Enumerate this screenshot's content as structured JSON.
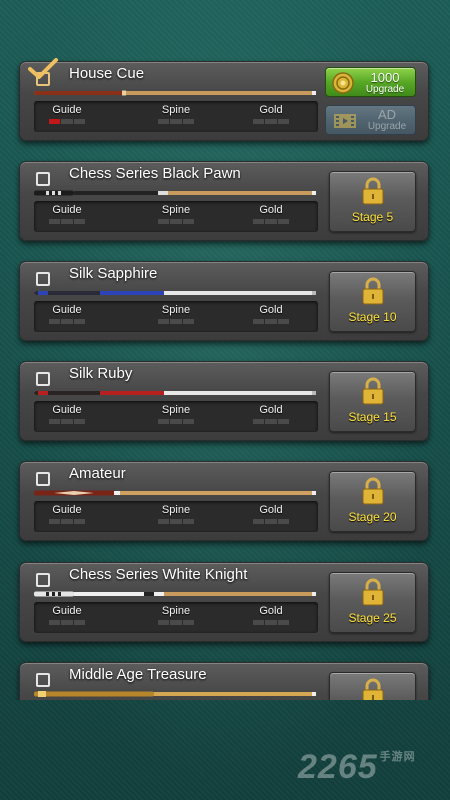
{
  "stat_labels": [
    "Guide",
    "Spine",
    "Gold"
  ],
  "colors": {
    "locked_stage_text": "#ffe23a",
    "upgrade_green": "#58a826",
    "stat_active": "#c01818",
    "background": "#1d5e58"
  },
  "cues": [
    {
      "name": "House Cue",
      "selected": true,
      "stats": [
        1,
        0,
        0
      ],
      "stat_max": 3,
      "action": {
        "type": "upgrade",
        "amount": "1000",
        "label": "Upgrade",
        "ad_label": "AD",
        "ad_sub": "Upgrade",
        "coin_icon": "coin-icon",
        "ad_icon": "film-icon"
      }
    },
    {
      "name": "Chess Series Black Pawn",
      "selected": false,
      "stats": [
        0,
        0,
        0
      ],
      "stat_max": 3,
      "action": {
        "type": "locked",
        "label": "Stage 5",
        "icon": "lock-icon"
      }
    },
    {
      "name": "Silk Sapphire",
      "selected": false,
      "stats": [
        0,
        0,
        0
      ],
      "stat_max": 3,
      "action": {
        "type": "locked",
        "label": "Stage 10",
        "icon": "lock-icon"
      }
    },
    {
      "name": "Silk Ruby",
      "selected": false,
      "stats": [
        0,
        0,
        0
      ],
      "stat_max": 3,
      "action": {
        "type": "locked",
        "label": "Stage 15",
        "icon": "lock-icon"
      }
    },
    {
      "name": "Amateur",
      "selected": false,
      "stats": [
        0,
        0,
        0
      ],
      "stat_max": 3,
      "action": {
        "type": "locked",
        "label": "Stage 20",
        "icon": "lock-icon"
      }
    },
    {
      "name": "Chess Series White Knight",
      "selected": false,
      "stats": [
        0,
        0,
        0
      ],
      "stat_max": 3,
      "action": {
        "type": "locked",
        "label": "Stage 25",
        "icon": "lock-icon"
      }
    },
    {
      "name": "Middle Age Treasure",
      "selected": false,
      "stats": [
        0,
        0,
        0
      ],
      "stat_max": 3,
      "action": {
        "type": "locked",
        "label": "",
        "icon": "lock-icon"
      }
    }
  ],
  "watermark": {
    "text": "2265",
    "suffix": "手游网"
  }
}
